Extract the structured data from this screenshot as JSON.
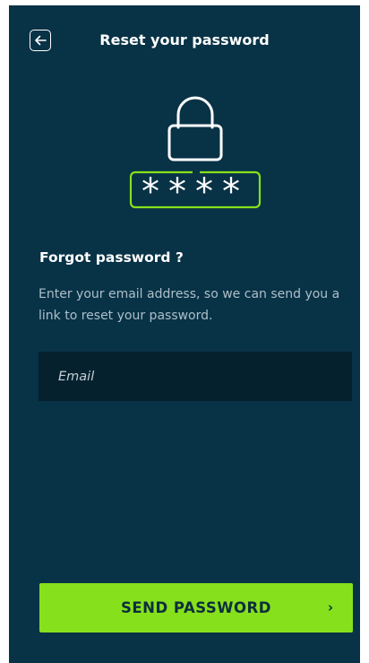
{
  "header": {
    "title": "Reset your password",
    "back_icon": "arrow-left-icon"
  },
  "illustration": {
    "lock_icon": "padlock-icon",
    "mask_text": "****"
  },
  "forgot": {
    "heading": "Forgot password ?",
    "description": "Enter your email address, so we can send you a link to reset your password."
  },
  "email": {
    "value": "",
    "placeholder": "Email"
  },
  "send_button": {
    "label": "SEND PASSWORD",
    "chevron": "›"
  },
  "colors": {
    "background": "#083246",
    "accent": "#87e01c",
    "input_background": "#05212d",
    "button_text": "#0c2e3d"
  }
}
